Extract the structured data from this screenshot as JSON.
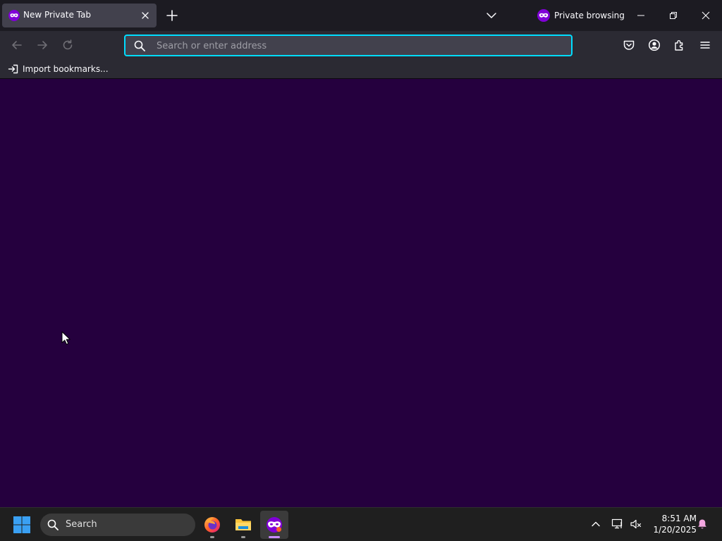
{
  "tab": {
    "title": "New Private Tab"
  },
  "toolbar": {
    "private_label": "Private browsing"
  },
  "urlbar": {
    "placeholder": "Search or enter address",
    "value": ""
  },
  "bookmarks": {
    "items": [
      {
        "label": "Import bookmarks..."
      }
    ]
  },
  "taskbar": {
    "search_label": "Search",
    "apps": [
      {
        "name": "firefox",
        "active": false
      },
      {
        "name": "file-explorer",
        "active": false
      },
      {
        "name": "firefox-private",
        "active": true
      }
    ],
    "time": "8:51 AM",
    "date": "1/20/2025"
  },
  "colors": {
    "content_bg": "#25003e",
    "titlebar_bg": "#1c1b22",
    "toolbar_bg": "#2b2a33",
    "urlbar_focus": "#00ddff",
    "private_purple": "#8000d7"
  },
  "icons": {
    "tab": "private-mask-icon",
    "close": "close-icon",
    "new_tab": "plus-icon",
    "tab_list": "chevron-down-icon",
    "back": "back-arrow-icon",
    "forward": "forward-arrow-icon",
    "reload": "reload-icon",
    "pocket": "pocket-icon",
    "account": "account-icon",
    "extensions": "puzzle-icon",
    "menu": "hamburger-menu-icon"
  }
}
